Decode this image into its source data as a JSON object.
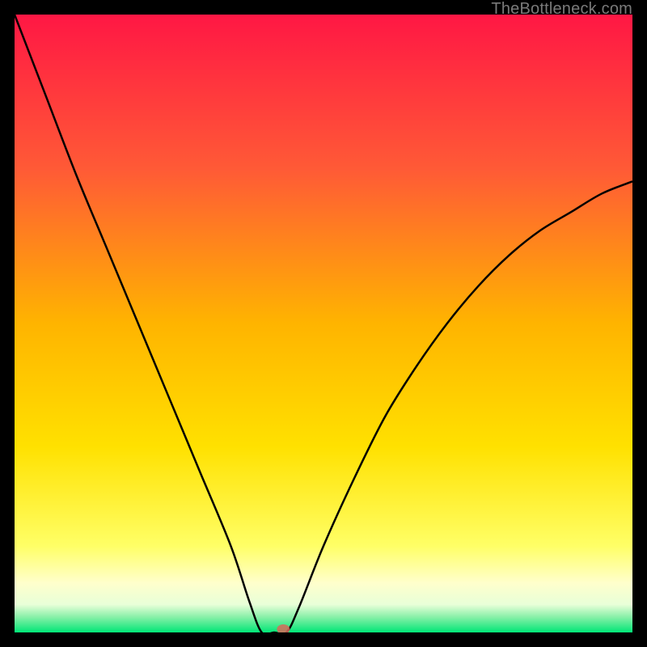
{
  "watermark": "TheBottleneck.com",
  "chart_data": {
    "type": "line",
    "title": "",
    "xlabel": "",
    "ylabel": "",
    "xlim": [
      0,
      100
    ],
    "ylim": [
      0,
      100
    ],
    "grid": false,
    "optimum_x": 42,
    "series": [
      {
        "name": "bottleneck-curve",
        "x": [
          0,
          5,
          10,
          15,
          20,
          25,
          30,
          35,
          38,
          40,
          42,
          44,
          46,
          50,
          55,
          60,
          65,
          70,
          75,
          80,
          85,
          90,
          95,
          100
        ],
        "y": [
          100,
          87,
          74,
          62,
          50,
          38,
          26,
          14,
          5,
          0,
          0,
          0,
          4,
          14,
          25,
          35,
          43,
          50,
          56,
          61,
          65,
          68,
          71,
          73
        ]
      }
    ],
    "marker": {
      "x": 43.5,
      "y": 0
    },
    "green_band": {
      "y_from": 0,
      "y_to": 3
    },
    "pale_band": {
      "y_from": 3,
      "y_to": 12
    },
    "gradient_stops": [
      {
        "pos": 0.0,
        "color": "#ff1744"
      },
      {
        "pos": 0.25,
        "color": "#ff5a36"
      },
      {
        "pos": 0.5,
        "color": "#ffb400"
      },
      {
        "pos": 0.7,
        "color": "#ffe100"
      },
      {
        "pos": 0.86,
        "color": "#ffff66"
      },
      {
        "pos": 0.92,
        "color": "#ffffcc"
      },
      {
        "pos": 0.955,
        "color": "#e8ffd8"
      },
      {
        "pos": 0.975,
        "color": "#88f0a8"
      },
      {
        "pos": 1.0,
        "color": "#00e676"
      }
    ]
  }
}
